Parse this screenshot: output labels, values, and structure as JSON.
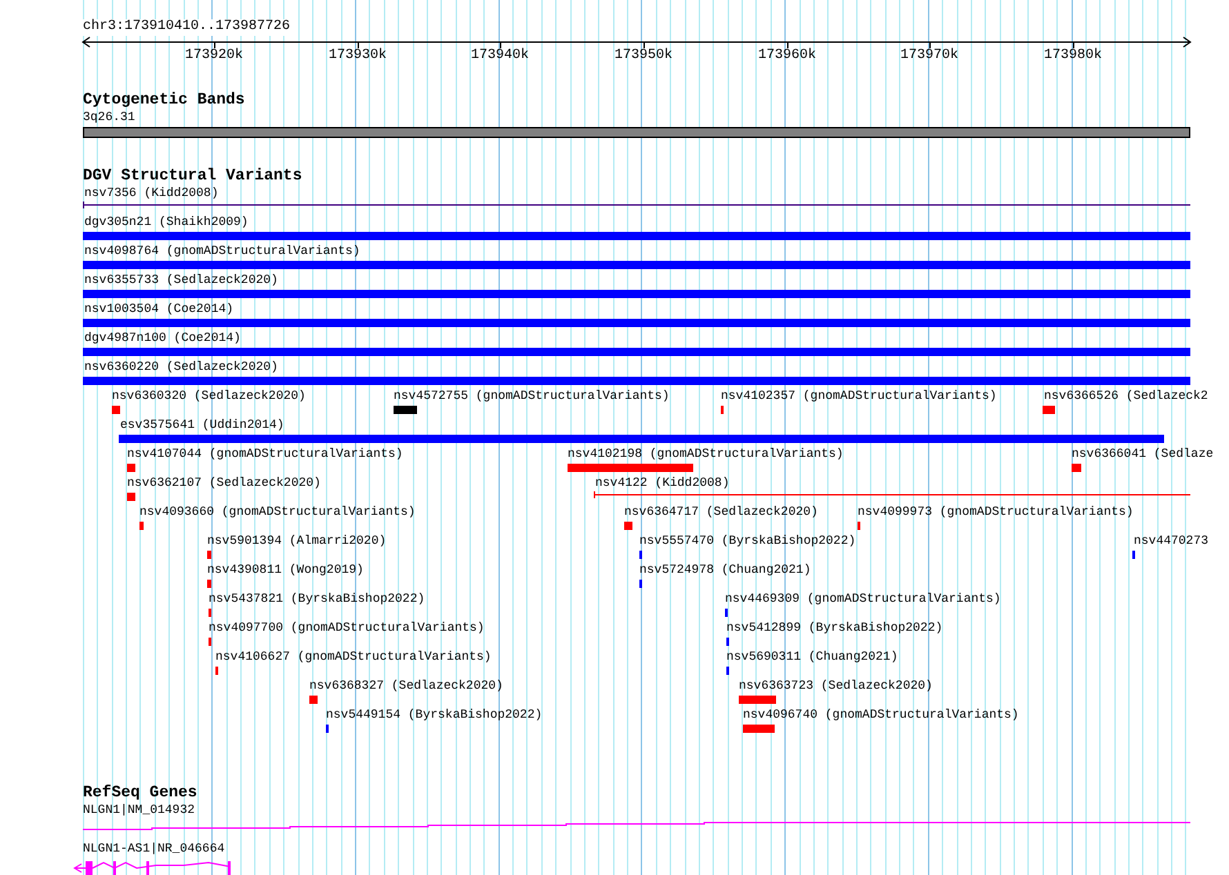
{
  "ruler": {
    "location": "chr3:173910410..173987726",
    "ticks": [
      "173920k",
      "173930k",
      "173940k",
      "173950k",
      "173960k",
      "173970k",
      "173980k"
    ]
  },
  "cytogenetic_bands": {
    "title": "Cytogenetic Bands",
    "bands": [
      {
        "label": "3q26.31"
      }
    ]
  },
  "dgv_structural_variants": {
    "title": "DGV Structural Variants",
    "rows": [
      {
        "features": [
          {
            "label": "nsv7356 (Kidd2008)",
            "kind": "line",
            "color": "#400080"
          }
        ]
      },
      {
        "features": [
          {
            "label": "dgv305n21 (Shaikh2009)",
            "kind": "bar",
            "color": "#0000ff"
          }
        ]
      },
      {
        "features": [
          {
            "label": "nsv4098764 (gnomADStructuralVariants)",
            "kind": "bar",
            "color": "#0000ff"
          }
        ]
      },
      {
        "features": [
          {
            "label": "nsv6355733 (Sedlazeck2020)",
            "kind": "bar",
            "color": "#0000ff"
          }
        ]
      },
      {
        "features": [
          {
            "label": "nsv1003504 (Coe2014)",
            "kind": "bar",
            "color": "#0000ff"
          }
        ]
      },
      {
        "features": [
          {
            "label": "dgv4987n100 (Coe2014)",
            "kind": "bar",
            "color": "#0000ff"
          }
        ]
      },
      {
        "features": [
          {
            "label": "nsv6360220 (Sedlazeck2020)",
            "kind": "bar",
            "color": "#0000ff"
          }
        ]
      },
      {
        "features": [
          {
            "label": "nsv6360320 (Sedlazeck2020)",
            "kind": "bar",
            "color": "#ff0000"
          },
          {
            "label": "nsv4572755 (gnomADStructuralVariants)",
            "kind": "bar",
            "color": "#000000"
          },
          {
            "label": "nsv4102357 (gnomADStructuralVariants)",
            "kind": "bar",
            "color": "#ff0000"
          },
          {
            "label": "nsv6366526 (Sedlazeck2",
            "kind": "bar",
            "color": "#ff0000"
          }
        ]
      },
      {
        "features": [
          {
            "label": "esv3575641 (Uddin2014)",
            "kind": "bar",
            "color": "#0000ff"
          }
        ]
      },
      {
        "features": [
          {
            "label": "nsv4107044 (gnomADStructuralVariants)",
            "kind": "bar",
            "color": "#ff0000"
          },
          {
            "label": "nsv4102198 (gnomADStructuralVariants)",
            "kind": "bar",
            "color": "#ff0000"
          },
          {
            "label": "nsv6366041 (Sedlaze",
            "kind": "bar",
            "color": "#ff0000"
          }
        ]
      },
      {
        "features": [
          {
            "label": "nsv6362107 (Sedlazeck2020)",
            "kind": "bar",
            "color": "#ff0000"
          },
          {
            "label": "nsv4122 (Kidd2008)",
            "kind": "line",
            "color": "#ff0000"
          }
        ]
      },
      {
        "features": [
          {
            "label": "nsv4093660 (gnomADStructuralVariants)",
            "kind": "bar",
            "color": "#ff0000"
          },
          {
            "label": "nsv6364717 (Sedlazeck2020)",
            "kind": "bar",
            "color": "#ff0000"
          },
          {
            "label": "nsv4099973 (gnomADStructuralVariants)",
            "kind": "bar",
            "color": "#ff0000"
          }
        ]
      },
      {
        "features": [
          {
            "label": "nsv5901394 (Almarri2020)",
            "kind": "bar",
            "color": "#ff0000"
          },
          {
            "label": "nsv5557470 (ByrskaBishop2022)",
            "kind": "bar",
            "color": "#0000ff"
          },
          {
            "label": "nsv4470273",
            "kind": "bar",
            "color": "#0000ff"
          }
        ]
      },
      {
        "features": [
          {
            "label": "nsv4390811 (Wong2019)",
            "kind": "bar",
            "color": "#ff0000"
          },
          {
            "label": "nsv5724978 (Chuang2021)",
            "kind": "bar",
            "color": "#0000ff"
          }
        ]
      },
      {
        "features": [
          {
            "label": "nsv5437821 (ByrskaBishop2022)",
            "kind": "bar",
            "color": "#ff0000"
          },
          {
            "label": "nsv4469309 (gnomADStructuralVariants)",
            "kind": "bar",
            "color": "#0000ff"
          }
        ]
      },
      {
        "features": [
          {
            "label": "nsv4097700 (gnomADStructuralVariants)",
            "kind": "bar",
            "color": "#ff0000"
          },
          {
            "label": "nsv5412899 (ByrskaBishop2022)",
            "kind": "bar",
            "color": "#0000ff"
          }
        ]
      },
      {
        "features": [
          {
            "label": "nsv4106627 (gnomADStructuralVariants)",
            "kind": "bar",
            "color": "#ff0000"
          },
          {
            "label": "nsv5690311 (Chuang2021)",
            "kind": "bar",
            "color": "#0000ff"
          }
        ]
      },
      {
        "features": [
          {
            "label": "nsv6368327 (Sedlazeck2020)",
            "kind": "bar",
            "color": "#ff0000"
          },
          {
            "label": "nsv6363723 (Sedlazeck2020)",
            "kind": "bar",
            "color": "#ff0000"
          }
        ]
      },
      {
        "features": [
          {
            "label": "nsv5449154 (ByrskaBishop2022)",
            "kind": "bar",
            "color": "#0000ff"
          },
          {
            "label": "nsv4096740 (gnomADStructuralVariants)",
            "kind": "bar",
            "color": "#ff0000"
          }
        ]
      }
    ]
  },
  "refseq_genes": {
    "title": "RefSeq Genes",
    "genes": [
      {
        "label": "NLGN1|NM_014932",
        "kind": "plus"
      },
      {
        "label": "NLGN1-AS1|NR_046664",
        "kind": "minus"
      }
    ]
  }
}
